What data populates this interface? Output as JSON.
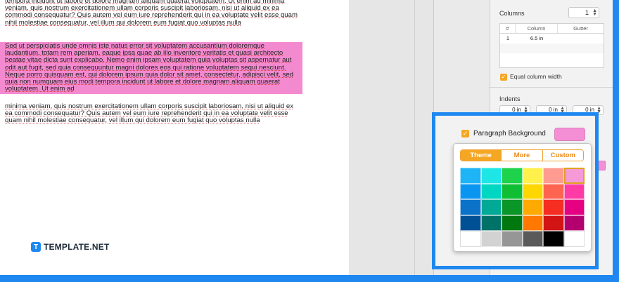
{
  "document": {
    "paragraph1": "tempora incidunt ut labore et dolore magnam aliquam quaerat voluptatem. Ut enim ad minima veniam, quis nostrum exercitationem ullam corporis suscipit laboriosam, nisi ut aliquid ex ea commodi consequatur? Quis autem vel eum iure reprehenderit qui in ea voluptate velit esse quam nihil molestiae consequatur, vel illum qui dolorem eum fugiat quo voluptas nulla",
    "paragraph2": "Sed ut perspiciatis unde omnis iste natus error sit voluptatem accusantium doloremque laudantium, totam rem aperiam, eaque ipsa quae ab illo inventore veritatis et quasi architecto beatae vitae dicta sunt explicabo. Nemo enim ipsam voluptatem quia voluptas sit aspernatur aut odit aut fugit, sed quia consequuntur magni dolores eos qui ratione voluptatem sequi nesciunt. Neque porro quisquam est, qui dolorem ipsum quia dolor sit amet, consectetur, adipisci velit, sed quia non numquam eius modi tempora incidunt ut labore et dolore magnam aliquam quaerat voluptatem. Ut enim ad",
    "paragraph3": "minima veniam, quis nostrum exercitationem ullam corporis suscipit laboriosam, nisi ut aliquid ex ea commodi consequatur? Quis autem vel eum iure reprehenderit qui in ea voluptate velit esse quam nihil molestiae consequatur, vel illum qui dolorem eum fugiat quo voluptas nulla",
    "highlight_color": "#f38ad0"
  },
  "brand": {
    "logo_mark": "T",
    "logo_text": "TEMPLATE.NET"
  },
  "sidebar": {
    "columns_label": "Columns",
    "columns_value": "1",
    "table": {
      "headers": [
        "#",
        "Column",
        "Gutter"
      ],
      "rows": [
        {
          "num": "1",
          "column": "6.5 in",
          "gutter": ""
        }
      ]
    },
    "equal_width_label": "Equal column width",
    "equal_width_checked": true,
    "indents_label": "Indents",
    "indent_values": [
      "0 in",
      "0 in",
      "0 in"
    ]
  },
  "paragraph_background": {
    "label": "Paragraph Background",
    "checked": true,
    "color": "#f48fd6"
  },
  "color_picker": {
    "tabs": [
      "Theme",
      "More",
      "Custom"
    ],
    "active_tab": "Theme",
    "selected_swatch": "#f59ad6",
    "swatches": [
      "#1eb4f5",
      "#1ee6e6",
      "#1ed24b",
      "#fff04b",
      "#ff9b91",
      "#f59ad6",
      "#0a96f0",
      "#00d7c3",
      "#0fbe32",
      "#ffd700",
      "#ff6450",
      "#ff3ca5",
      "#0a73c8",
      "#00aa96",
      "#0a9628",
      "#ffaa00",
      "#f52d23",
      "#e60082",
      "#005096",
      "#007369",
      "#00780f",
      "#ff7800",
      "#d21414",
      "#b4006e",
      "#ffffff",
      "#d2d2d2",
      "#969696",
      "#5a5a5a",
      "#000000",
      "#ffffff"
    ]
  },
  "colors": {
    "accent_blue": "#1e88f0",
    "accent_orange": "#f5a623"
  }
}
